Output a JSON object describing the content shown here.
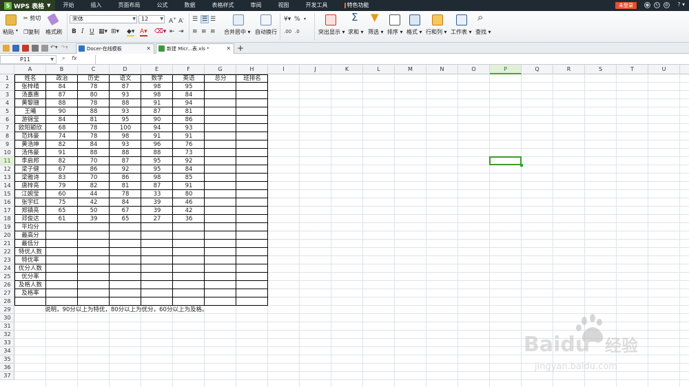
{
  "app": {
    "logo": "WPS 表格",
    "menus": [
      "开始",
      "插入",
      "页面布局",
      "公式",
      "数据",
      "表格样式",
      "审阅",
      "视图",
      "开发工具",
      "特色功能"
    ],
    "login_label": "未登录",
    "help_label": "?"
  },
  "ribbon": {
    "paste": "粘贴",
    "cut": "剪切",
    "copy": "复制",
    "format_painter": "格式刷",
    "font_name": "宋体",
    "font_size": "12",
    "bold": "B",
    "italic": "I",
    "underline": "U",
    "merge_center": "合并居中",
    "wrap_text": "自动换行",
    "highlight": "突出显示",
    "sum": "求和",
    "filter": "筛选",
    "sort": "排序",
    "format": "格式",
    "rows_cols": "行和列",
    "worksheet": "工作表",
    "find": "查找"
  },
  "doc_tabs": [
    {
      "label": "Docer-在线模板"
    },
    {
      "label": "新建 Micr...表.xls *"
    }
  ],
  "formula_bar": {
    "cell_ref": "P11",
    "fx": "fx",
    "content": ""
  },
  "columns": [
    "A",
    "B",
    "C",
    "D",
    "E",
    "F",
    "G",
    "H",
    "I",
    "J",
    "K",
    "L",
    "M",
    "N",
    "O",
    "P",
    "Q",
    "R",
    "S",
    "T",
    "U"
  ],
  "rows": [
    "1",
    "2",
    "3",
    "4",
    "5",
    "6",
    "7",
    "8",
    "9",
    "10",
    "11",
    "12",
    "13",
    "14",
    "15",
    "16",
    "17",
    "18",
    "19",
    "20",
    "21",
    "22",
    "23",
    "24",
    "25",
    "26",
    "27",
    "28",
    "29",
    "30",
    "31",
    "32",
    "33",
    "34",
    "35",
    "36",
    "37"
  ],
  "selected": {
    "column": "P",
    "row": "11"
  },
  "table": {
    "headers": [
      "姓名",
      "政治",
      "历史",
      "语文",
      "数学",
      "英语",
      "总分",
      "班排名"
    ],
    "students": [
      [
        "张梓晴",
        "84",
        "78",
        "87",
        "98",
        "95"
      ],
      [
        "汤嘉惠",
        "87",
        "80",
        "93",
        "98",
        "84"
      ],
      [
        "黄黎珊",
        "88",
        "78",
        "88",
        "91",
        "94"
      ],
      [
        "王曦",
        "90",
        "88",
        "93",
        "87",
        "81"
      ],
      [
        "游锦莹",
        "84",
        "81",
        "95",
        "90",
        "86"
      ],
      [
        "欧阳颖欣",
        "68",
        "78",
        "100",
        "94",
        "93"
      ],
      [
        "范炜豪",
        "74",
        "78",
        "98",
        "91",
        "91"
      ],
      [
        "黄浩坤",
        "82",
        "84",
        "93",
        "96",
        "76"
      ],
      [
        "汤伟豪",
        "91",
        "88",
        "88",
        "88",
        "73"
      ],
      [
        "李启邦",
        "82",
        "70",
        "87",
        "95",
        "92"
      ],
      [
        "梁子健",
        "67",
        "86",
        "92",
        "95",
        "84"
      ],
      [
        "梁雅诗",
        "83",
        "70",
        "86",
        "98",
        "85"
      ],
      [
        "唐梓亮",
        "79",
        "82",
        "81",
        "87",
        "91"
      ],
      [
        "江婉莹",
        "60",
        "44",
        "78",
        "33",
        "80"
      ],
      [
        "张宇红",
        "75",
        "42",
        "84",
        "39",
        "46"
      ],
      [
        "郑镇亮",
        "65",
        "50",
        "67",
        "39",
        "42"
      ],
      [
        "邓俊达",
        "61",
        "39",
        "65",
        "27",
        "36"
      ]
    ],
    "stat_labels": [
      "平均分",
      "最高分",
      "最低分",
      "特优人数",
      "特优率",
      "优分人数",
      "优分率",
      "及格人数",
      "及格率"
    ]
  },
  "note": "说明，90分以上为特优，80分以上为优分，60分以上为及格。",
  "watermark": {
    "brand": "Baidu",
    "brand_cn": "经验",
    "url": "jingyan.baidu.com"
  }
}
